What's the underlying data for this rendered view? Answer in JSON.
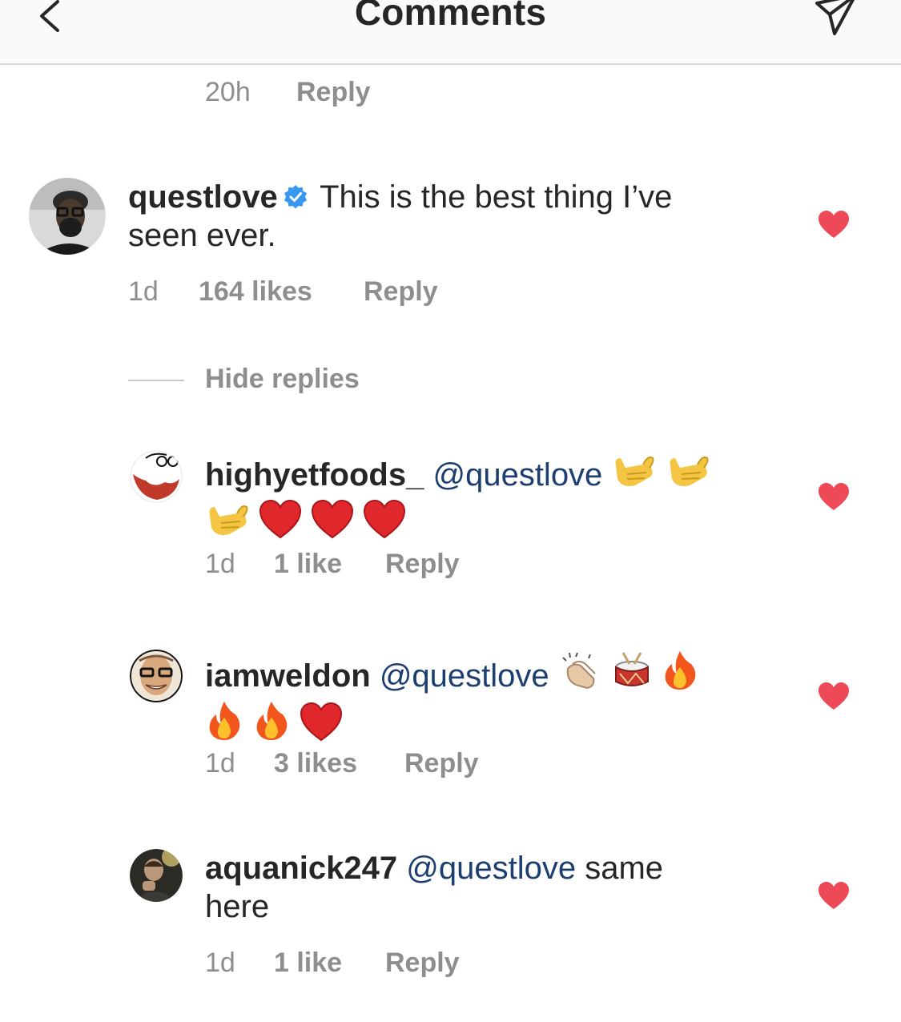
{
  "header": {
    "title": "Comments",
    "back_icon": "chevron-left-icon",
    "send_icon": "paper-plane-icon"
  },
  "previous_comment_meta": {
    "time": "20h",
    "reply": "Reply"
  },
  "main_comment": {
    "username": "questlove",
    "verified": true,
    "text_line1": "This is the best thing I’ve",
    "text_line2": "seen ever.",
    "time": "1d",
    "likes": "164 likes",
    "reply": "Reply",
    "liked": true
  },
  "hide_replies": "Hide replies",
  "replies": [
    {
      "username": "highyetfoods_",
      "mention": "@questlove",
      "text": "",
      "emojis": [
        "call-me-hand",
        "call-me-hand",
        "call-me-hand",
        "red-heart",
        "red-heart",
        "red-heart"
      ],
      "time": "1d",
      "likes": "1 like",
      "reply": "Reply",
      "liked": true
    },
    {
      "username": "iamweldon",
      "mention": "@questlove",
      "text": "",
      "emojis": [
        "clapping-hands",
        "drum",
        "fire",
        "fire",
        "fire",
        "red-heart"
      ],
      "time": "1d",
      "likes": "3 likes",
      "reply": "Reply",
      "liked": true
    },
    {
      "username": "aquanick247",
      "mention": "@questlove",
      "text_line1": "same",
      "text_line2": "here",
      "time": "1d",
      "likes": "1 like",
      "reply": "Reply",
      "liked": true
    }
  ],
  "colors": {
    "like_heart": "#ed4956",
    "mention": "#1d3e70",
    "meta_gray": "#8e8e8e",
    "verified_blue": "#3897f0"
  }
}
